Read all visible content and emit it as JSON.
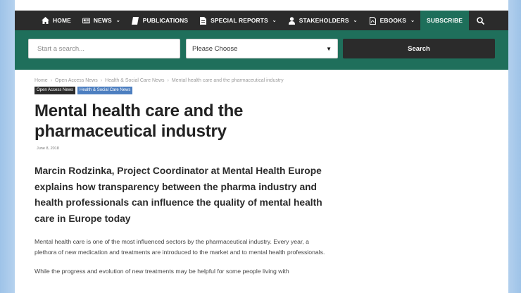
{
  "nav": {
    "items": [
      {
        "label": "HOME",
        "icon": "home-icon",
        "caret": false
      },
      {
        "label": "NEWS",
        "icon": "newspaper-icon",
        "caret": true
      },
      {
        "label": "PUBLICATIONS",
        "icon": "book-icon",
        "caret": false
      },
      {
        "label": "SPECIAL REPORTS",
        "icon": "document-icon",
        "caret": true
      },
      {
        "label": "STAKEHOLDERS",
        "icon": "user-icon",
        "caret": true
      },
      {
        "label": "EBOOKS",
        "icon": "pdf-icon",
        "caret": true
      }
    ],
    "subscribe_label": "SUBSCRIBE",
    "caret_glyph": "⌄"
  },
  "search": {
    "placeholder": "Start a search...",
    "select_value": "Please Choose",
    "button_label": "Search"
  },
  "breadcrumb": {
    "items": [
      "Home",
      "Open Access News",
      "Health & Social Care News",
      "Mental health care and the pharmaceutical industry"
    ],
    "separator": "›"
  },
  "tags": [
    "Open Access News",
    "Health & Social Care News"
  ],
  "article": {
    "title": "Mental health care and the pharmaceutical industry",
    "date": "June 8, 2018",
    "lede": "Marcin Rodzinka, Project Coordinator at Mental Health Europe explains how transparency between the pharma industry and health professionals can influence the quality of mental health care in Europe today",
    "paragraph1": "Mental health care is one of the most influenced sectors by the pharmaceutical industry. Every year, a plethora of new medication and treatments are introduced to the market and to mental health professionals.",
    "paragraph2": "While the progress and evolution of new treatments may be helpful for some people living with"
  },
  "colors": {
    "nav_bg": "#2b2b2b",
    "accent_green": "#1f6f5b",
    "tag_blue": "#4d7fc0"
  }
}
